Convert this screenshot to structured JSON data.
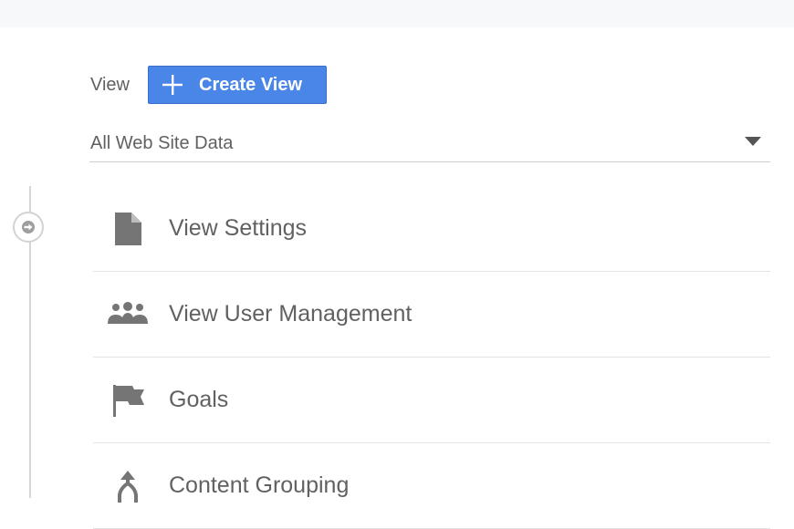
{
  "view_section": {
    "label": "View",
    "create_button": {
      "label": "Create View",
      "icon": "plus-icon",
      "color": "#4a86e8"
    },
    "selector": {
      "selected": "All Web Site Data",
      "icon": "caret-down-icon"
    }
  },
  "menu": {
    "items": [
      {
        "label": "View Settings",
        "icon": "document-icon"
      },
      {
        "label": "View User Management",
        "icon": "people-icon"
      },
      {
        "label": "Goals",
        "icon": "flag-icon"
      },
      {
        "label": "Content Grouping",
        "icon": "merge-arrow-icon"
      }
    ]
  },
  "colors": {
    "text": "#616161",
    "icon": "#757575",
    "accent": "#4a86e8"
  }
}
